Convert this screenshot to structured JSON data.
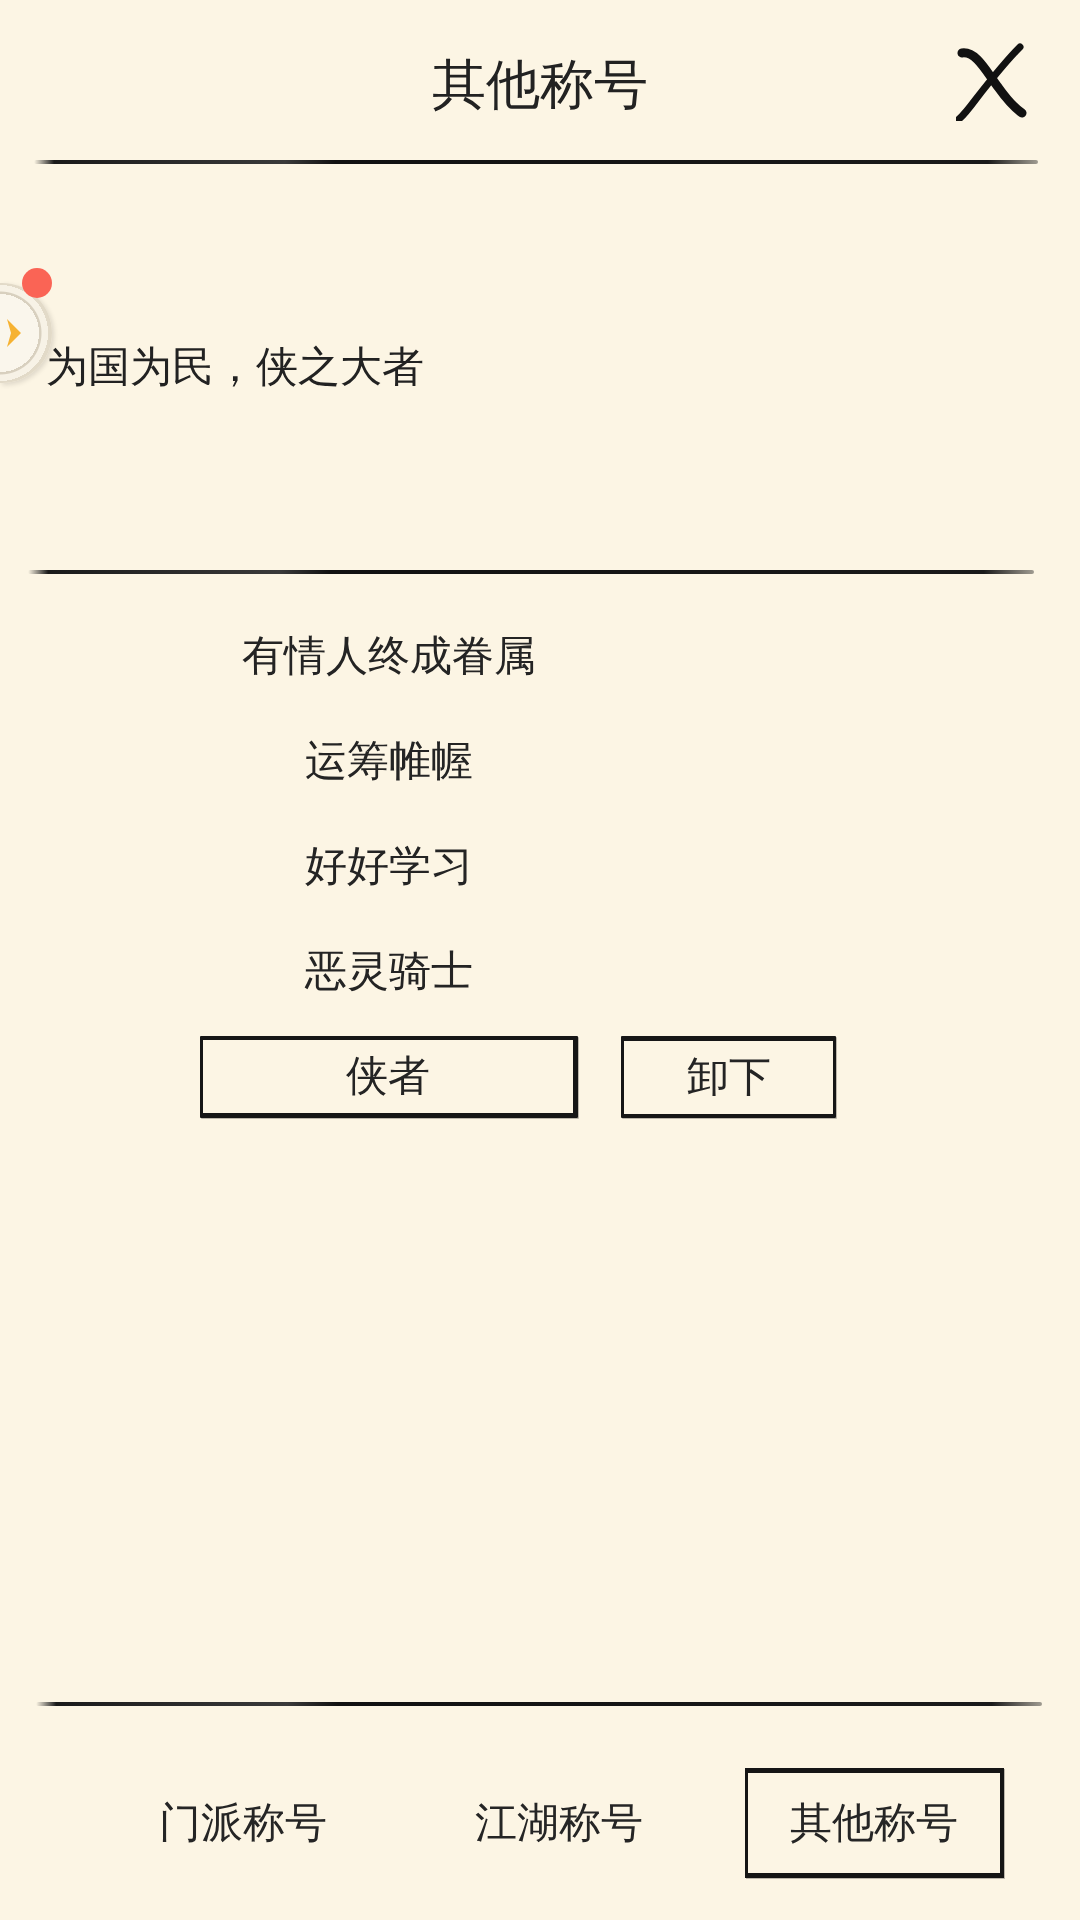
{
  "header": {
    "title": "其他称号"
  },
  "floating_button": {
    "badge": true
  },
  "description": "为国为民，侠之大者",
  "titles": [
    {
      "label": "有情人终成眷属",
      "selected": false
    },
    {
      "label": "运筹帷幄",
      "selected": false
    },
    {
      "label": "好好学习",
      "selected": false
    },
    {
      "label": "恶灵骑士",
      "selected": false
    },
    {
      "label": "侠者",
      "selected": true
    }
  ],
  "unequip_button": "卸下",
  "tabs": [
    {
      "label": "门派称号",
      "selected": false
    },
    {
      "label": "江湖称号",
      "selected": false
    },
    {
      "label": "其他称号",
      "selected": true
    }
  ]
}
